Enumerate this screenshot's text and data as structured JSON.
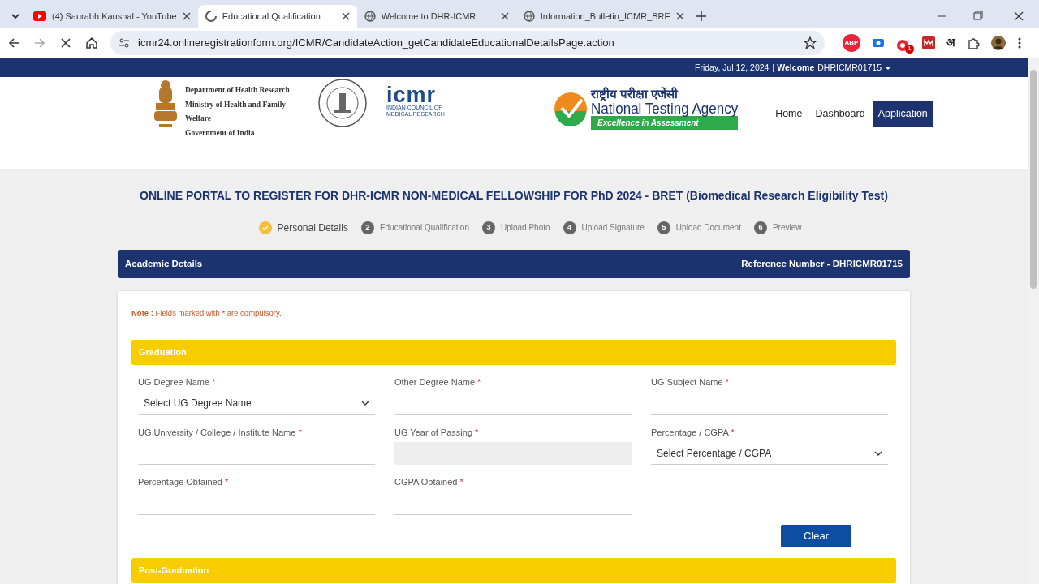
{
  "browser": {
    "tabs": [
      {
        "title": "(4) Saurabh Kaushal - YouTube",
        "kind": "video",
        "selected": false
      },
      {
        "title": "Educational Qualification",
        "kind": "loading",
        "selected": true
      },
      {
        "title": "Welcome to DHR-ICMR",
        "kind": "globe",
        "selected": false
      },
      {
        "title": "Information_Bulletin_ICMR_BRE",
        "kind": "globe",
        "selected": false
      }
    ],
    "url": "icmr24.onlineregistrationform.org/ICMR/CandidateAction_getCandidateEducationalDetailsPage.action",
    "extensions": [
      {
        "kind": "badge",
        "label": "ABP"
      },
      {
        "kind": "camera"
      },
      {
        "kind": "counter",
        "label": "1"
      },
      {
        "kind": "grid"
      },
      {
        "kind": "letter",
        "label": "अ"
      },
      {
        "kind": "puzzle"
      }
    ]
  },
  "topbar": {
    "date": "Friday, Jul 12, 2024",
    "welcome_label": "| Welcome",
    "user": "DHRICMR01715"
  },
  "header": {
    "dept_lines": [
      "Department of Health Research",
      "Ministry of Health and Family Welfare",
      "Government of India"
    ],
    "icmr": {
      "name": "icmr",
      "subtitle": "INDIAN COUNCIL OF MEDICAL RESEARCH"
    },
    "nta": {
      "hindi": "राष्ट्रीय परीक्षा एजेंसी",
      "name": "National Testing Agency",
      "tagline": "Excellence in Assessment"
    },
    "nav": [
      {
        "label": "Home",
        "selected": false
      },
      {
        "label": "Dashboard",
        "selected": false
      },
      {
        "label": "Application",
        "selected": true
      }
    ]
  },
  "title": "ONLINE PORTAL TO REGISTER FOR DHR-ICMR NON-MEDICAL FELLOWSHIP FOR PhD 2024 - BRET (Biomedical Research Eligibility Test)",
  "steps": [
    {
      "label": "Personal Details",
      "done": true
    },
    {
      "number": "2",
      "label": "Educational Qualification",
      "done": false
    },
    {
      "number": "3",
      "label": "Upload Photo",
      "done": false
    },
    {
      "number": "4",
      "label": "Upload Signature",
      "done": false
    },
    {
      "number": "5",
      "label": "Upload Document",
      "done": false
    },
    {
      "number": "6",
      "label": "Preview",
      "done": false
    }
  ],
  "section_bar": {
    "title": "Academic Details",
    "reference": "Reference Number - DHRICMR01715"
  },
  "note": {
    "label": "Note :",
    "before": "Fields marked with",
    "marker": "*",
    "after": "are compulsory."
  },
  "sections": [
    {
      "title": "Graduation",
      "fields": [
        {
          "label": "UG Degree Name",
          "mark": "*",
          "kind": "select",
          "value": "Select UG Degree Name"
        },
        {
          "label": "Other Degree Name",
          "mark": "*",
          "kind": "input"
        },
        {
          "label": "UG Subject Name",
          "mark": "*",
          "kind": "input"
        },
        {
          "label": "UG University / College / Institute Name",
          "mark": "*",
          "kind": "input"
        },
        {
          "label": "UG Year of Passing",
          "mark": "*",
          "kind": "input",
          "disabled": true
        },
        {
          "label": "Percentage / CGPA",
          "mark": "*",
          "kind": "select",
          "value": "Select Percentage / CGPA"
        },
        {
          "label": "Percentage Obtained",
          "mark": "*",
          "kind": "input"
        },
        {
          "label": "CGPA Obtained",
          "mark": "*",
          "kind": "input"
        }
      ],
      "button": "Clear"
    },
    {
      "title": "Post-Graduation"
    }
  ]
}
